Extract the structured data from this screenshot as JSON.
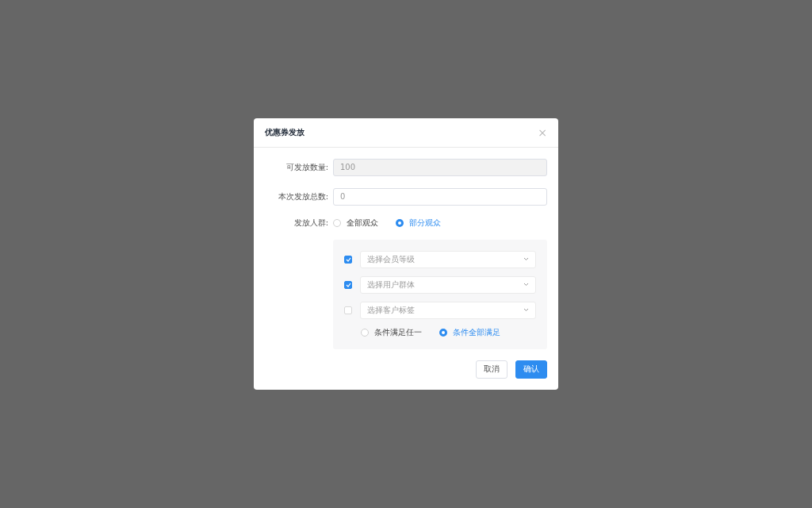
{
  "dialog": {
    "title": "优惠券发放",
    "close": "×"
  },
  "fields": [
    {
      "label": "可发放数量:",
      "placeholder": "100",
      "disabled": true
    },
    {
      "label": "本次发放总数:",
      "placeholder": "0",
      "disabled": false
    }
  ],
  "audience": {
    "label": "发放人群:",
    "options": [
      {
        "label": "全部观众",
        "selected": false
      },
      {
        "label": "部分观众",
        "selected": true
      }
    ]
  },
  "conditions": [
    {
      "placeholder": "选择会员等级",
      "checked": true
    },
    {
      "placeholder": "选择用户群体",
      "checked": true
    },
    {
      "placeholder": "选择客户标签",
      "checked": false
    }
  ],
  "match": [
    {
      "label": "条件满足任一",
      "selected": false
    },
    {
      "label": "条件全部满足",
      "selected": true
    }
  ],
  "buttons": [
    {
      "label": "取消",
      "kind": "secondary"
    },
    {
      "label": "确认",
      "kind": "primary"
    }
  ]
}
